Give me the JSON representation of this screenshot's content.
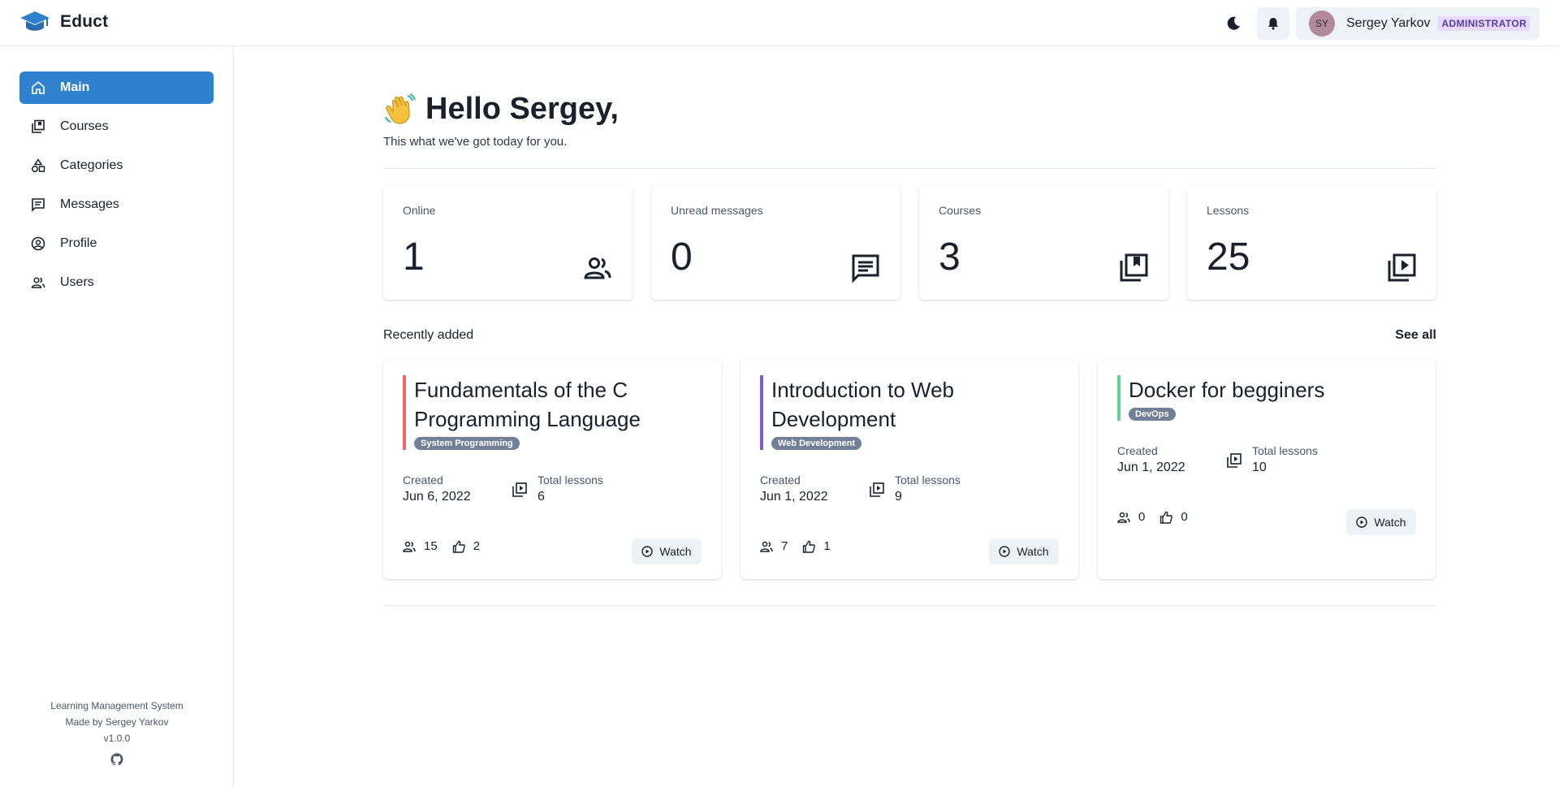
{
  "app": {
    "name": "Educt"
  },
  "header": {
    "user": {
      "initials": "SY",
      "name": "Sergey Yarkov",
      "role": "ADMINISTRATOR"
    },
    "icons": [
      "moon-icon",
      "bell-icon"
    ]
  },
  "sidebar": {
    "items": [
      {
        "label": "Main",
        "icon": "home-icon",
        "active": true
      },
      {
        "label": "Courses",
        "icon": "library-icon",
        "active": false
      },
      {
        "label": "Categories",
        "icon": "shapes-icon",
        "active": false
      },
      {
        "label": "Messages",
        "icon": "message-icon",
        "active": false
      },
      {
        "label": "Profile",
        "icon": "user-circle-icon",
        "active": false
      },
      {
        "label": "Users",
        "icon": "users-icon",
        "active": false
      }
    ],
    "footer": {
      "line1": "Learning Management System",
      "line2": "Made by Sergey Yarkov",
      "version": "v1.0.0",
      "icon": "github-icon"
    }
  },
  "greeting": {
    "emoji": "waving-hand",
    "title": "Hello Sergey,",
    "subtitle": "This what we've got today for you."
  },
  "stats": [
    {
      "label": "Online",
      "value": "1",
      "icon": "users-icon"
    },
    {
      "label": "Unread messages",
      "value": "0",
      "icon": "message-icon"
    },
    {
      "label": "Courses",
      "value": "3",
      "icon": "library-icon"
    },
    {
      "label": "Lessons",
      "value": "25",
      "icon": "video-library-icon"
    }
  ],
  "recent": {
    "title": "Recently added",
    "see_all": "See all",
    "courses": [
      {
        "title": "Fundamentals of the C Programming Language",
        "tag": "System Programming",
        "accent": "#f56565",
        "created_label": "Created",
        "created": "Jun 6, 2022",
        "lessons_label": "Total lessons",
        "lessons": "6",
        "students": "15",
        "likes": "2",
        "watch": "Watch"
      },
      {
        "title": "Introduction to Web Development",
        "tag": "Web Development",
        "accent": "#805ad5",
        "created_label": "Created",
        "created": "Jun 1, 2022",
        "lessons_label": "Total lessons",
        "lessons": "9",
        "students": "7",
        "likes": "1",
        "watch": "Watch"
      },
      {
        "title": "Docker for begginers",
        "tag": "DevOps",
        "accent": "#68d391",
        "created_label": "Created",
        "created": "Jun 1, 2022",
        "lessons_label": "Total lessons",
        "lessons": "10",
        "students": "0",
        "likes": "0",
        "watch": "Watch"
      }
    ]
  },
  "colors": {
    "primary": "#3182ce",
    "badge": "#718096",
    "role_bg": "#e9d8fd",
    "role_text": "#553c9a"
  }
}
